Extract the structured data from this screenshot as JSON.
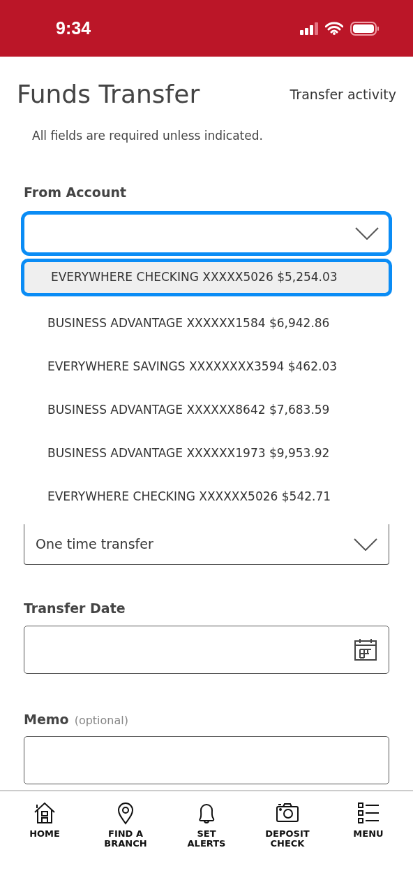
{
  "status_bar": {
    "time": "9:34"
  },
  "header": {
    "title": "Funds Transfer",
    "link": "Transfer activity"
  },
  "note": "All fields are required unless indicated.",
  "from_account": {
    "label": "From Account",
    "expanded": true,
    "options": [
      {
        "label": "EVERYWHERE CHECKING XXXXX5026 $5,254.03",
        "selected": true
      },
      {
        "label": "BUSINESS ADVANTAGE XXXXXX1584 $6,942.86",
        "selected": false
      },
      {
        "label": "EVERYWHERE SAVINGS XXXXXXXX3594 $462.03",
        "selected": false
      },
      {
        "label": "BUSINESS ADVANTAGE XXXXXX8642 $7,683.59",
        "selected": false
      },
      {
        "label": "BUSINESS ADVANTAGE XXXXXX1973 $9,953.92",
        "selected": false
      },
      {
        "label": "EVERYWHERE CHECKING XXXXXX5026 $542.71",
        "selected": false
      }
    ]
  },
  "frequency": {
    "value": "One time transfer"
  },
  "transfer_date": {
    "label": "Transfer Date"
  },
  "memo": {
    "label": "Memo",
    "hint": "(optional)"
  },
  "bottom_nav": [
    {
      "kind": "home",
      "label": "HOME"
    },
    {
      "kind": "pin",
      "label": "FIND A BRANCH"
    },
    {
      "kind": "bell",
      "label": "SET ALERTS"
    },
    {
      "kind": "camera",
      "label": "DEPOSIT CHECK"
    },
    {
      "kind": "menu",
      "label": "MENU"
    }
  ]
}
